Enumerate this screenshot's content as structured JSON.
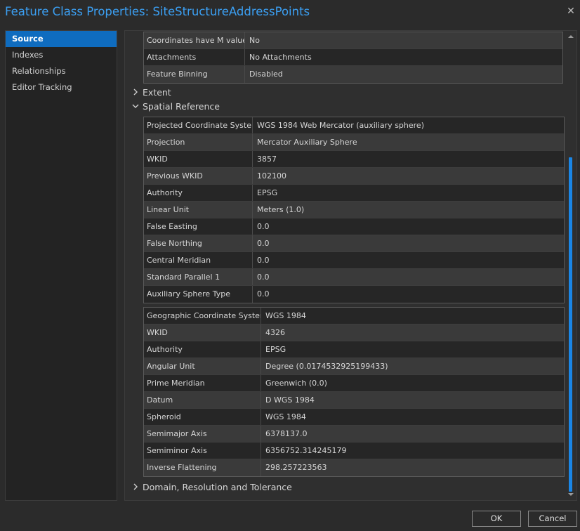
{
  "window": {
    "title": "Feature Class Properties: SiteStructureAddressPoints",
    "close_glyph": "✕"
  },
  "sidebar": {
    "items": [
      {
        "label": "Source",
        "active": true
      },
      {
        "label": "Indexes"
      },
      {
        "label": "Relationships"
      },
      {
        "label": "Editor Tracking"
      }
    ]
  },
  "general_table": {
    "rows": [
      {
        "key": "Coordinates have M value",
        "value": "No"
      },
      {
        "key": "Attachments",
        "value": "No Attachments"
      },
      {
        "key": "Feature Binning",
        "value": "Disabled"
      }
    ]
  },
  "sections": {
    "extent": {
      "label": "Extent",
      "expanded": false
    },
    "spatial_reference": {
      "label": "Spatial Reference",
      "expanded": true
    },
    "domain": {
      "label": "Domain, Resolution and Tolerance",
      "expanded": false
    }
  },
  "projected_table": {
    "rows": [
      {
        "key": "Projected Coordinate System",
        "value": "WGS 1984 Web Mercator (auxiliary sphere)"
      },
      {
        "key": "Projection",
        "value": "Mercator Auxiliary Sphere"
      },
      {
        "key": "WKID",
        "value": "3857"
      },
      {
        "key": "Previous WKID",
        "value": "102100"
      },
      {
        "key": "Authority",
        "value": "EPSG"
      },
      {
        "key": "Linear Unit",
        "value": "Meters (1.0)"
      },
      {
        "key": "False Easting",
        "value": "0.0"
      },
      {
        "key": "False Northing",
        "value": "0.0"
      },
      {
        "key": "Central Meridian",
        "value": "0.0"
      },
      {
        "key": "Standard Parallel 1",
        "value": "0.0"
      },
      {
        "key": "Auxiliary Sphere Type",
        "value": "0.0"
      }
    ]
  },
  "geographic_table": {
    "rows": [
      {
        "key": "Geographic Coordinate System",
        "value": "WGS 1984"
      },
      {
        "key": "WKID",
        "value": "4326"
      },
      {
        "key": "Authority",
        "value": "EPSG"
      },
      {
        "key": "Angular Unit",
        "value": "Degree (0.0174532925199433)"
      },
      {
        "key": "Prime Meridian",
        "value": "Greenwich (0.0)"
      },
      {
        "key": "Datum",
        "value": "D WGS 1984"
      },
      {
        "key": "Spheroid",
        "value": "WGS 1984"
      },
      {
        "key": "Semimajor Axis",
        "value": "6378137.0"
      },
      {
        "key": "Semiminor Axis",
        "value": "6356752.314245179"
      },
      {
        "key": "Inverse Flattening",
        "value": "298.257223563"
      }
    ]
  },
  "buttons": {
    "ok": "OK",
    "cancel": "Cancel"
  },
  "colors": {
    "accent": "#3b9ff2",
    "selection": "#0f6cbf",
    "scroll_thumb": "#1a86e6"
  }
}
